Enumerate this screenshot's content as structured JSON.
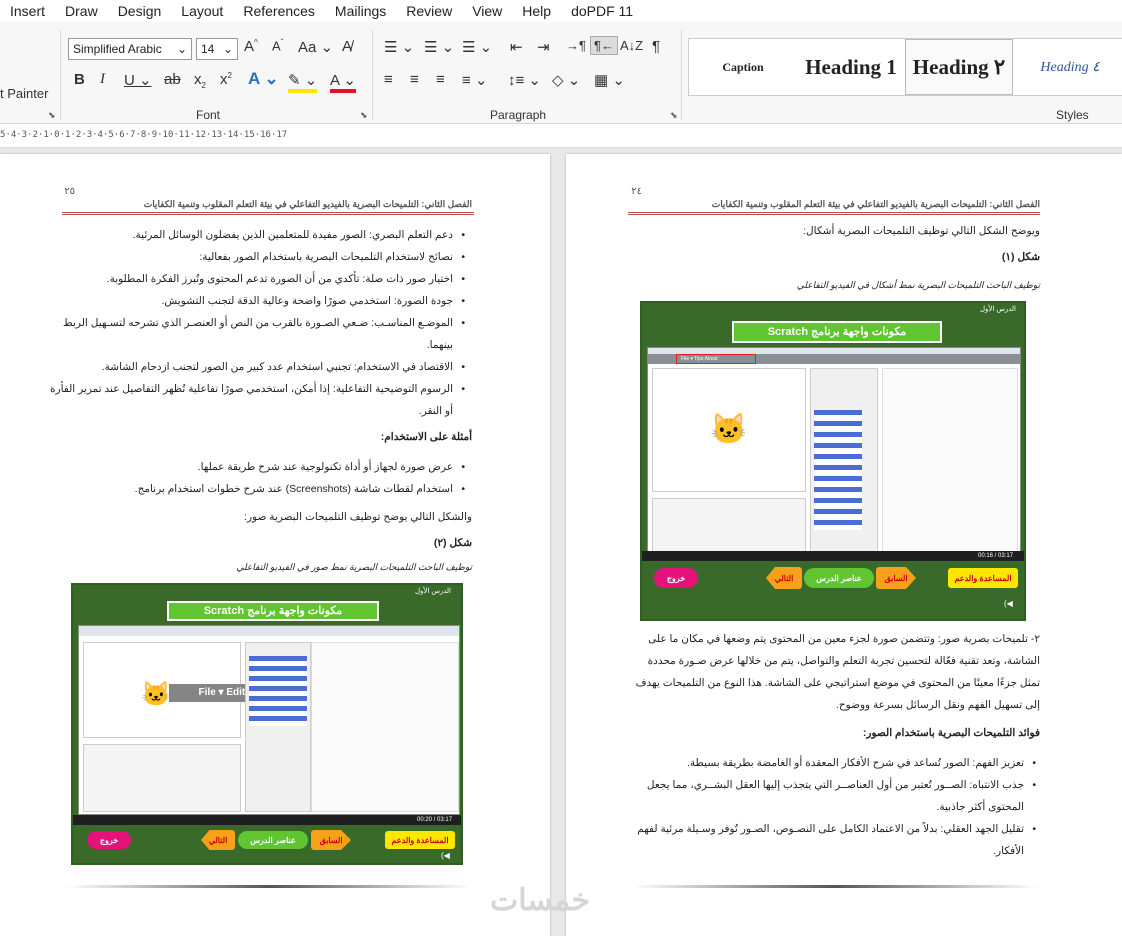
{
  "menu": [
    "Insert",
    "Draw",
    "Design",
    "Layout",
    "References",
    "Mailings",
    "Review",
    "View",
    "Help",
    "doPDF 11"
  ],
  "ribbon": {
    "painter": "t Painter",
    "font_name": "Simplified Arabic",
    "font_size": "14",
    "groups": {
      "font": "Font",
      "paragraph": "Paragraph",
      "styles": "Styles"
    },
    "styles": [
      "Caption",
      "Heading 1",
      "Heading ٢",
      "Heading ٤"
    ]
  },
  "ruler": "5·4·3·2·1·0·1·2·3·4·5·6·7·8·9·10·11·12·13·14·15·16·17",
  "left_page": {
    "page_number": "٢٥",
    "header": "الفصل الثاني: التلميحات البصرية بالفيديو التفاعلي في بيئة التعلم المقلوب وتنمية الكفايات",
    "bullets1": [
      "دعم التعلم البصري: الصور مفيدة للمتعلمين الذين يفضلون الوسائل المرئية.",
      "نصائح لاستخدام التلميحات البصرية باستخدام الصور بفعالية:",
      "اختيار صور ذات صلة: تأكدي من أن الصورة تدعم المحتوى وتُبرز الفكرة المطلوبة.",
      "جودة الصورة: استخدمي صورًا واضحة وعالية الدقة لتجنب التشويش.",
      "الموضـع المناسـب: ضـعي الصـورة بالقرب من النص أو العنصـر الذي تشرحه لتسـهيل الربط",
      "بينهما.",
      "الاقتصاد في الاستخدام: تجنبي استخدام عدد كبير من الصور لتجنب ازدحام الشاشة.",
      "الرسوم التوضيحية التفاعلية: إذا أمكن، استخدمي صورًا تفاعلية تُظهر التفاصيل عند تمرير الفأرة",
      "أو النقر."
    ],
    "examples_heading": "أمثلة على الاستخدام:",
    "bullets2": [
      "عرض صورة لجهاز أو أداة تكنولوجية عند شرح طريقة عملها.",
      "استخدام لقطات شاشة (Screenshots) عند شرح خطوات استخدام برنامج."
    ],
    "intro": "والشكل التالي يوضح توظيف التلميحات البصرية صور:",
    "fig_label": "شكل (٢)",
    "fig_caption": "توظيف الباحث التلميحات البصرية نمط صور في الفيديو التفاعلي",
    "figure": {
      "lesson": "الدرس الأول",
      "title": "مكونات واجهة برنامج Scratch",
      "menu": "File ▾   Edit ▾   Tips   About",
      "time": "00:20 / 03:17",
      "help": "المساعدة والدعم",
      "prev": "السابق",
      "elements": "عناصر الدرس",
      "next": "التالي",
      "exit": "خروج"
    }
  },
  "right_page": {
    "page_number": "٢٤",
    "header": "الفصل الثاني: التلميحات البصرية بالفيديو التفاعلي في بيئة التعلم المقلوب وتنمية الكفايات",
    "intro": "ويوضح الشكل التالي توظيف التلميحات البصرية أشكال:",
    "fig_label": "شكل (١)",
    "fig_caption": "توظيف الباحث التلميحات البصرية نمط أشكال في الفيديو التفاعلي",
    "figure": {
      "lesson": "الدرس الأول",
      "title": "مكونات واجهة برنامج Scratch",
      "menu": "File ▾  Tips  About",
      "time": "00:16 / 03:17",
      "help": "المساعدة والدعم",
      "prev": "السابق",
      "elements": "عناصر الدرس",
      "next": "التالي",
      "exit": "خروج"
    },
    "para": [
      "٢- تلميحات بصرية صور: وتتضمن صورة لجزء معين من المحتوى يتم وضعها في مكان ما على",
      "الشاشة، وتعد تقنية فعّالة لتحسين تجربة التعلم والتواصل، يتم من خلالها عرض صـورة محددة",
      "تمثل جزءًا معينًا من المحتوى في موضع استراتيجي على الشاشة. هذا النوع من التلميحات يهدف",
      "إلى تسهيل الفهم ونقل الرسائل بسرعة ووضوح."
    ],
    "benefits_heading": "فوائد التلميحات البصرية باستخدام الصور:",
    "bullets": [
      "تعزيز الفهم: الصور تُساعد في شرح الأفكار المعقدة أو الغامضة بطريقة بسيطة.",
      "جذب الانتباه: الصــور تُعتبر من أول العناصــر التي يتجذب إليها العقل البشــري، مما يجعل",
      "المحتوى أكثر جاذبية.",
      "تقليل الجهد العقلي: بدلاً من الاعتماد الكامل على النصـوص، الصـور تُوفر وسـيلة مرئية لفهم",
      "الأفكار."
    ]
  },
  "watermark": "خمسات"
}
